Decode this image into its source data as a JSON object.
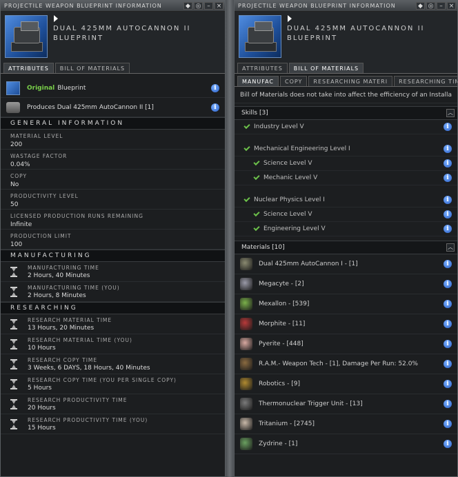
{
  "left": {
    "title": "PROJECTILE WEAPON BLUEPRINT INFORMATION",
    "name_line1": "DUAL 425MM AUTOCANNON II",
    "name_line2": "BLUEPRINT",
    "tabs": [
      "ATTRIBUTES",
      "BILL OF MATERIALS"
    ],
    "original_word": "Original",
    "original_rest": "Blueprint",
    "produces": "Produces Dual 425mm AutoCannon II [1]",
    "general_header": "GENERAL INFORMATION",
    "general": [
      {
        "label": "MATERIAL LEVEL",
        "value": "200"
      },
      {
        "label": "WASTAGE FACTOR",
        "value": "0.04%"
      },
      {
        "label": "COPY",
        "value": "No"
      },
      {
        "label": "PRODUCTIVITY LEVEL",
        "value": "50"
      },
      {
        "label": "LICENSED PRODUCTION RUNS REMAINING",
        "value": "Infinite"
      },
      {
        "label": "PRODUCTION LIMIT",
        "value": "100"
      }
    ],
    "manufacturing_header": "MANUFACTURING",
    "manufacturing": [
      {
        "label": "MANUFACTURING TIME",
        "value": "2 Hours, 40 Minutes"
      },
      {
        "label": "MANUFACTURING TIME (YOU)",
        "value": "2 Hours, 8 Minutes"
      }
    ],
    "researching_header": "RESEARCHING",
    "researching": [
      {
        "label": "RESEARCH MATERIAL TIME",
        "value": "13 Hours, 20 Minutes"
      },
      {
        "label": "RESEARCH MATERIAL TIME (YOU)",
        "value": "10 Hours"
      },
      {
        "label": "RESEARCH COPY TIME",
        "value": "3 Weeks, 6 DAYS, 18 Hours, 40 Minutes"
      },
      {
        "label": "RESEARCH COPY TIME (YOU PER SINGLE COPY)",
        "value": "5 Hours"
      },
      {
        "label": "RESEARCH PRODUCTIVITY TIME",
        "value": "20 Hours"
      },
      {
        "label": "RESEARCH PRODUCTIVITY TIME (YOU)",
        "value": "15 Hours"
      }
    ]
  },
  "right": {
    "title": "PROJECTILE WEAPON BLUEPRINT INFORMATION",
    "name_line1": "DUAL 425MM AUTOCANNON II",
    "name_line2": "BLUEPRINT",
    "tabs": [
      "ATTRIBUTES",
      "BILL OF MATERIALS"
    ],
    "subtabs": [
      "MANUFAC",
      "COPY",
      "RESEARCHING MATERI",
      "RESEARCHING TIME P"
    ],
    "note": "Bill of Materials does not take into affect the efficiency of an Installa",
    "skills_header": "Skills [3]",
    "skills": [
      {
        "label": "Industry Level V",
        "indent": 0
      },
      {
        "label": "",
        "indent": -1
      },
      {
        "label": "Mechanical Engineering Level I",
        "indent": 0
      },
      {
        "label": "Science Level V",
        "indent": 1
      },
      {
        "label": "Mechanic Level V",
        "indent": 1
      },
      {
        "label": "",
        "indent": -1
      },
      {
        "label": "Nuclear Physics Level I",
        "indent": 0
      },
      {
        "label": "Science Level V",
        "indent": 1
      },
      {
        "label": "Engineering Level V",
        "indent": 1
      }
    ],
    "materials_header": "Materials [10]",
    "materials": [
      {
        "label": "Dual 425mm AutoCannon I - [1]",
        "color": "#8a8a70"
      },
      {
        "label": "Megacyte - [2]",
        "color": "#9a9aa8"
      },
      {
        "label": "Mexallon - [539]",
        "color": "#7ab04a"
      },
      {
        "label": "Morphite - [11]",
        "color": "#b83a3a"
      },
      {
        "label": "Pyerite - [448]",
        "color": "#d8a8a0"
      },
      {
        "label": "R.A.M.- Weapon Tech - [1], Damage Per Run: 52.0%",
        "color": "#8a6a40"
      },
      {
        "label": "Robotics - [9]",
        "color": "#b08a30"
      },
      {
        "label": "Thermonuclear Trigger Unit - [13]",
        "color": "#7a7a7a"
      },
      {
        "label": "Tritanium - [2745]",
        "color": "#c8b8a8"
      },
      {
        "label": "Zydrine - [1]",
        "color": "#6aa060"
      }
    ]
  },
  "icons": {
    "info": "i",
    "collapse": "⮝"
  }
}
